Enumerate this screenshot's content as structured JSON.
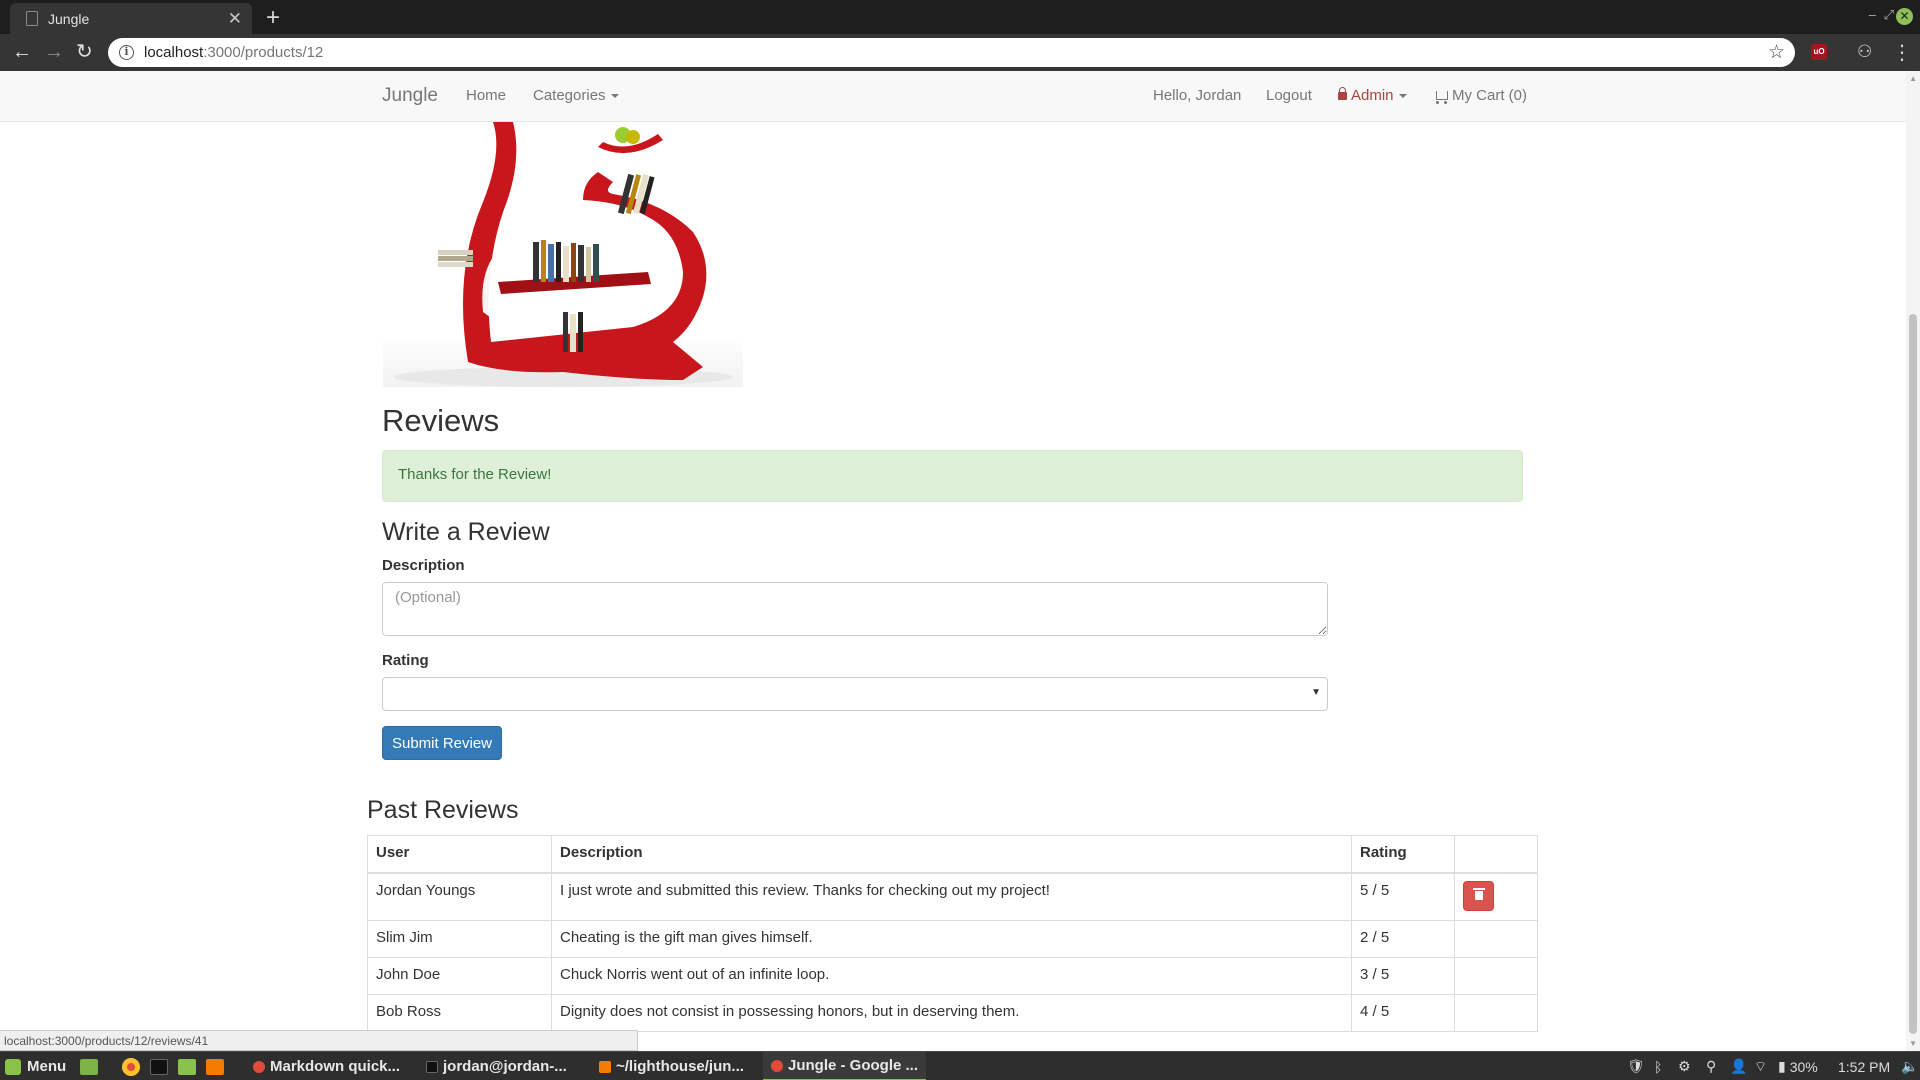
{
  "browser": {
    "tab_title": "Jungle",
    "url_host": "localhost",
    "url_path": ":3000/products/12",
    "status_url": "localhost:3000/products/12/reviews/41"
  },
  "navbar": {
    "brand": "Jungle",
    "home": "Home",
    "categories": "Categories",
    "greeting": "Hello, Jordan",
    "logout": "Logout",
    "admin": "Admin",
    "cart": "My Cart (0)"
  },
  "reviews": {
    "title": "Reviews",
    "flash": "Thanks for the Review!",
    "write_title": "Write a Review",
    "description_label": "Description",
    "description_placeholder": "(Optional)",
    "rating_label": "Rating",
    "rating_value": "",
    "submit": "Submit Review"
  },
  "past_reviews": {
    "title": "Past Reviews",
    "headers": [
      "User",
      "Description",
      "Rating",
      ""
    ],
    "rows": [
      {
        "user": "Jordan Youngs",
        "description": "I just wrote and submitted this review. Thanks for checking out my project!",
        "rating": "5 / 5",
        "deletable": true
      },
      {
        "user": "Slim Jim",
        "description": "Cheating is the gift man gives himself.",
        "rating": "2 / 5",
        "deletable": false
      },
      {
        "user": "John Doe",
        "description": "Chuck Norris went out of an infinite loop.",
        "rating": "3 / 5",
        "deletable": false
      },
      {
        "user": "Bob Ross",
        "description": "Dignity does not consist in possessing honors, but in deserving them.",
        "rating": "4 / 5",
        "deletable": false
      }
    ]
  },
  "taskbar": {
    "menu": "Menu",
    "windows": [
      "Markdown quick...",
      "jordan@jordan-...",
      "~/lighthouse/jun...",
      "Jungle - Google ..."
    ],
    "battery": "30%",
    "clock": "1:52 PM"
  },
  "colors": {
    "primary": "#337ab7",
    "danger": "#d9534f",
    "success_bg": "#dff0d8",
    "success_text": "#3c763d",
    "shelf_red": "#c8161d"
  }
}
